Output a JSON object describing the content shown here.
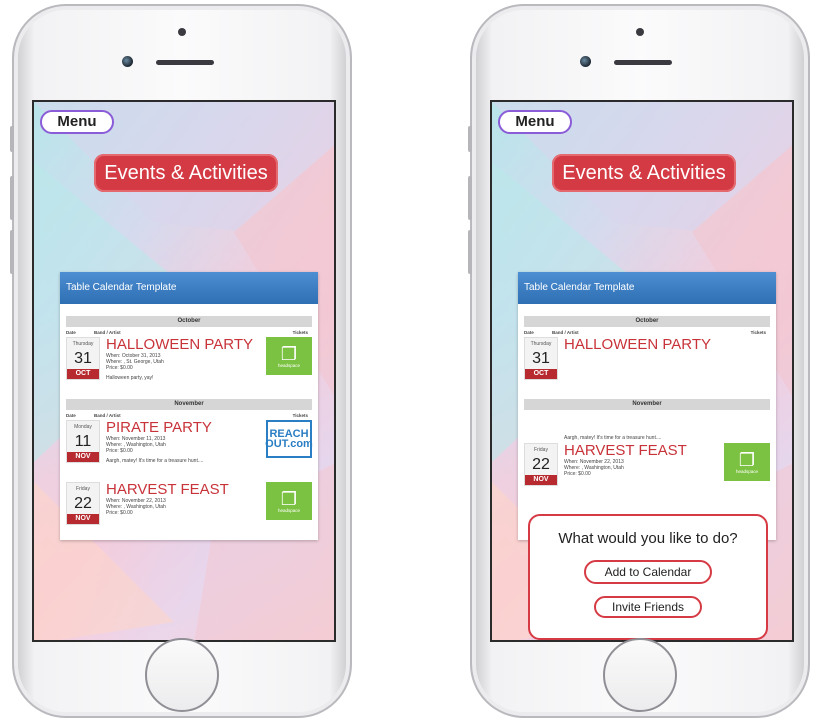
{
  "app": {
    "menu_label": "Menu",
    "title": "Events & Activities"
  },
  "calendar": {
    "header": "Table Calendar Template",
    "columns": {
      "date": "Date",
      "band": "Band / Artist",
      "tickets": "Tickets"
    },
    "months": [
      "October",
      "November"
    ],
    "events": [
      {
        "dow": "Thursday",
        "day": "31",
        "month": "OCT",
        "name": "HALLOWEEN PARTY",
        "when": "When: October 31, 2013",
        "where": "Where: , St. George, Utah",
        "price": "Price: $0.00",
        "desc": "Halloween party, yay!",
        "ticket": "headspace"
      },
      {
        "dow": "Monday",
        "day": "11",
        "month": "NOV",
        "name": "PIRATE PARTY",
        "when": "When: November 11, 2013",
        "where": "Where: , Washington, Utah",
        "price": "Price: $0.00",
        "desc": "Aargh, matey! It's time for a treasure hunt....",
        "ticket_line1": "REACH",
        "ticket_line2": "OUT.com"
      },
      {
        "dow": "Friday",
        "day": "22",
        "month": "NOV",
        "name": "HARVEST FEAST",
        "when": "When: November 22, 2013",
        "where": "Where: , Washington, Utah",
        "price": "Price: $0.00",
        "desc": "",
        "ticket": "headspace"
      }
    ]
  },
  "dialog": {
    "question": "What would you like to do?",
    "add_to_calendar": "Add to Calendar",
    "invite_friends": "Invite Friends"
  },
  "colors": {
    "accent_red": "#d43a44",
    "menu_border": "#8a5cd8",
    "header_blue": "#3a7cc2",
    "ticket_green": "#7cc242"
  }
}
